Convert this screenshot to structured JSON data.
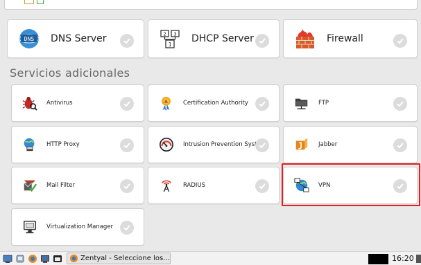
{
  "sections": {
    "additional_title": "Servicios adicionales"
  },
  "core_services": [
    {
      "label": "DNS Server",
      "icon": "dns-server-icon"
    },
    {
      "label": "DHCP Server",
      "icon": "dhcp-server-icon"
    },
    {
      "label": "Firewall",
      "icon": "firewall-icon"
    }
  ],
  "additional_services": [
    {
      "label": "Antivirus",
      "icon": "antivirus-icon"
    },
    {
      "label": "Certification Authority",
      "icon": "certification-authority-icon"
    },
    {
      "label": "FTP",
      "icon": "ftp-icon"
    },
    {
      "label": "HTTP Proxy",
      "icon": "http-proxy-icon"
    },
    {
      "label": "Intrusion Prevention System",
      "icon": "ips-icon"
    },
    {
      "label": "Jabber",
      "icon": "jabber-icon"
    },
    {
      "label": "Mail Filter",
      "icon": "mail-filter-icon"
    },
    {
      "label": "RADIUS",
      "icon": "radius-icon"
    },
    {
      "label": "VPN",
      "icon": "vpn-icon"
    },
    {
      "label": "Virtualization Manager",
      "icon": "virtualization-manager-icon"
    }
  ],
  "taskbar": {
    "window_title": "Zentyal - Seleccione los...",
    "clock": "16:20"
  },
  "colors": {
    "highlight": "#e02020",
    "check_bg": "#dcdcdc",
    "card_bg": "#ffffff",
    "page_bg": "#e9e9e9"
  }
}
